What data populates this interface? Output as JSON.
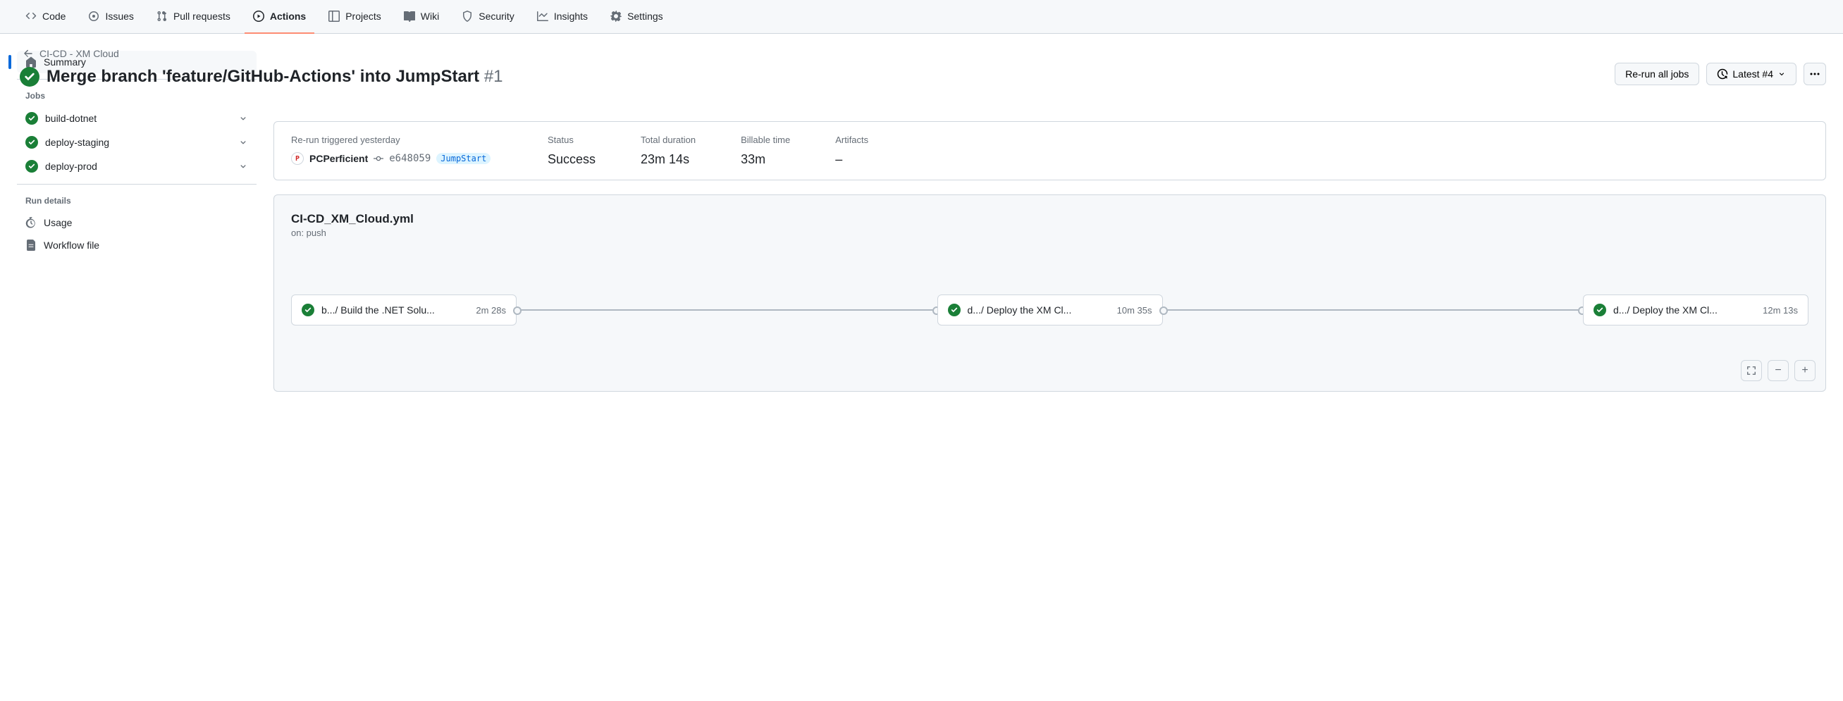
{
  "tabs": [
    {
      "label": "Code"
    },
    {
      "label": "Issues"
    },
    {
      "label": "Pull requests"
    },
    {
      "label": "Actions"
    },
    {
      "label": "Projects"
    },
    {
      "label": "Wiki"
    },
    {
      "label": "Security"
    },
    {
      "label": "Insights"
    },
    {
      "label": "Settings"
    }
  ],
  "breadcrumb": "CI-CD - XM Cloud",
  "page_title": "Merge branch 'feature/GitHub-Actions' into JumpStart",
  "run_number": "#1",
  "header_buttons": {
    "rerun": "Re-run all jobs",
    "latest": "Latest #4"
  },
  "sidebar": {
    "summary": "Summary",
    "jobs_label": "Jobs",
    "jobs": [
      {
        "name": "build-dotnet"
      },
      {
        "name": "deploy-staging"
      },
      {
        "name": "deploy-prod"
      }
    ],
    "run_details_label": "Run details",
    "usage": "Usage",
    "workflow_file": "Workflow file"
  },
  "summary": {
    "trigger_label": "Re-run triggered yesterday",
    "author": "PCPerficient",
    "commit": "e648059",
    "branch": "JumpStart",
    "status_label": "Status",
    "status_value": "Success",
    "duration_label": "Total duration",
    "duration_value": "23m 14s",
    "billable_label": "Billable time",
    "billable_value": "33m",
    "artifacts_label": "Artifacts",
    "artifacts_value": "–"
  },
  "workflow": {
    "file": "CI-CD_XM_Cloud.yml",
    "trigger": "on: push",
    "nodes": [
      {
        "label": "b.../ Build the .NET Solu...",
        "duration": "2m 28s"
      },
      {
        "label": "d.../ Deploy the XM Cl...",
        "duration": "10m 35s"
      },
      {
        "label": "d.../ Deploy the XM Cl...",
        "duration": "12m 13s"
      }
    ]
  }
}
